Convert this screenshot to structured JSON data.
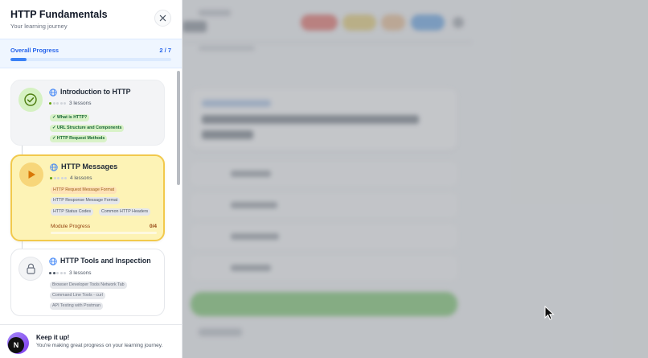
{
  "sidebar": {
    "title": "HTTP Fundamentals",
    "subtitle": "Your learning journey",
    "overall_progress": {
      "label": "Overall Progress",
      "count": "2 / 7",
      "fraction": 0.1
    },
    "modules": [
      {
        "title": "Introduction to HTTP",
        "status": "completed",
        "lessons": "3 lessons",
        "difficulty_level": 1,
        "topics": [
          "✓ What is HTTP?",
          "✓ URL Structure and Components",
          "✓ HTTP Request Methods"
        ]
      },
      {
        "title": "HTTP Messages",
        "status": "in-progress",
        "lessons": "4 lessons",
        "difficulty_level": 1,
        "topics": [
          "HTTP Request Message Format",
          "HTTP Response Message Format",
          "HTTP Status Codes",
          "Common HTTP Headers"
        ],
        "module_progress": {
          "label": "Module Progress",
          "count": "0/4",
          "fraction": 0
        }
      },
      {
        "title": "HTTP Tools and Inspection",
        "status": "locked",
        "lessons": "3 lessons",
        "difficulty_level": 2,
        "topics": [
          "Browser Developer Tools Network Tab",
          "Command Line Tools - curl",
          "API Testing with Postman"
        ]
      }
    ],
    "footer": {
      "avatar_letter": "N",
      "title": "Keep it up!",
      "message": "You're making great progress on your learning journey."
    }
  },
  "colors": {
    "accent_blue": "#3b82f6",
    "completed_green": "#65a30d",
    "active_yellow": "#f2c94c",
    "active_play": "#d97706"
  }
}
